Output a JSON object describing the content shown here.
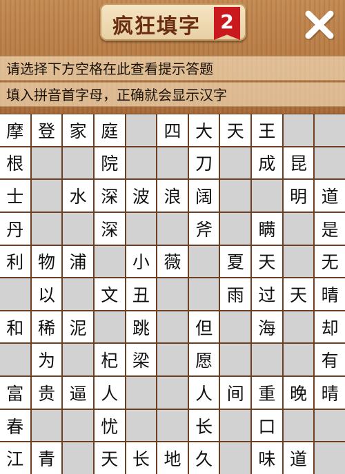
{
  "header": {
    "title": "疯狂填字",
    "badge": "2"
  },
  "hints": [
    "请选择下方空格在此查看提示答题",
    "填入拼音首字母，正确就会显示汉字"
  ],
  "grid": [
    [
      "摩",
      "登",
      "家",
      "庭",
      "",
      "四",
      "大",
      "天",
      "王",
      "",
      ""
    ],
    [
      "根",
      "",
      "",
      "院",
      "",
      "",
      "刀",
      "",
      "成",
      "昆",
      ""
    ],
    [
      "士",
      "",
      "水",
      "深",
      "波",
      "浪",
      "阔",
      "",
      "",
      "明",
      "道"
    ],
    [
      "丹",
      "",
      "",
      "深",
      "",
      "",
      "斧",
      "",
      "瞒",
      "",
      "是"
    ],
    [
      "利",
      "物",
      "浦",
      "",
      "小",
      "薇",
      "",
      "夏",
      "天",
      "",
      "无"
    ],
    [
      "",
      "以",
      "",
      "文",
      "丑",
      "",
      "",
      "雨",
      "过",
      "天",
      "晴"
    ],
    [
      "和",
      "稀",
      "泥",
      "",
      "跳",
      "",
      "但",
      "",
      "海",
      "",
      "却"
    ],
    [
      "",
      "为",
      "",
      "杞",
      "梁",
      "",
      "愿",
      "",
      "",
      "",
      "有"
    ],
    [
      "富",
      "贵",
      "逼",
      "人",
      "",
      "",
      "人",
      "间",
      "重",
      "晚",
      "晴"
    ],
    [
      "春",
      "",
      "",
      "忧",
      "",
      "",
      "长",
      "",
      "口",
      "",
      ""
    ],
    [
      "江",
      "青",
      "",
      "天",
      "长",
      "地",
      "久",
      "",
      "味",
      "道",
      ""
    ]
  ]
}
